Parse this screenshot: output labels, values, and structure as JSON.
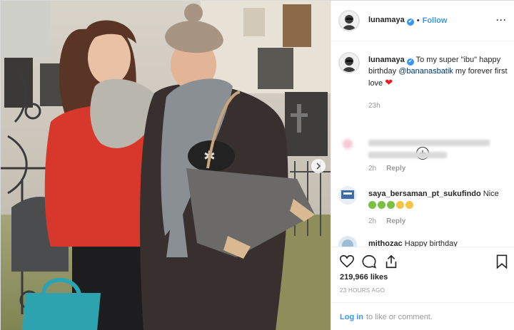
{
  "post": {
    "username": "lunamaya",
    "verified_mark": "✔",
    "separator": "•",
    "follow_label": "Follow",
    "more_icon": "more-options-icon",
    "image_description_icons": [
      "carousel-next-icon"
    ]
  },
  "caption": {
    "username": "lunamaya",
    "text_before": " To my super \"ibu\" happy birthday ",
    "mention": "@bananasbatik",
    "text_after": " my forever first love ",
    "emoji": "❤",
    "time": "23h"
  },
  "comments": [
    {
      "username": "",
      "text": "",
      "time": "2h",
      "reply_label": "Reply",
      "blurred": true
    },
    {
      "username": "saya_bersaman_pt_sukufindo",
      "text": " Nice",
      "emojis": [
        "#f4c542",
        "#f4c542",
        "#f4c542",
        "#f4c542",
        "#f4c542"
      ],
      "time": "2h",
      "reply_label": "Reply"
    },
    {
      "username": "mithozac",
      "text": " Happy birthday"
    }
  ],
  "actions": {
    "like_icon": "heart-icon",
    "comment_icon": "comment-icon",
    "share_icon": "share-icon",
    "save_icon": "bookmark-icon"
  },
  "likes": "219,966 likes",
  "timestamp": "23 HOURS AGO",
  "footer": {
    "login_label": "Log in",
    "rest": "to like or comment."
  },
  "colors": {
    "accent": "#3897f0",
    "mention": "#003569",
    "muted": "#999999",
    "border": "#efefef"
  }
}
